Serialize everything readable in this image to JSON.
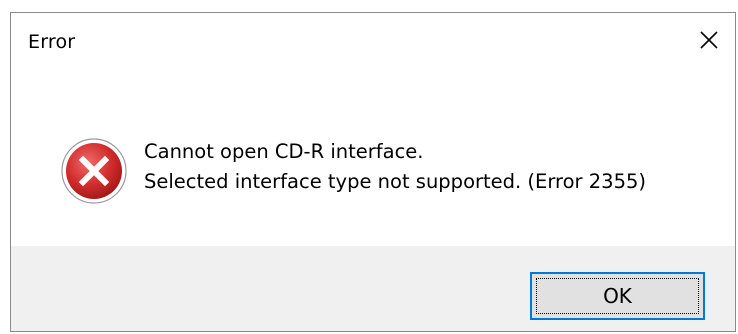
{
  "dialog": {
    "title": "Error",
    "close_icon": "close-icon",
    "icon": "error-icon",
    "message_line_1": "Cannot open CD-R interface.",
    "message_line_2": "Selected interface type not supported. (Error 2355)",
    "ok_label": "OK"
  },
  "colors": {
    "error_red": "#d32f2f",
    "accent": "#0078d7",
    "footer_bg": "#f0f0f0",
    "button_bg": "#e1e1e1"
  }
}
